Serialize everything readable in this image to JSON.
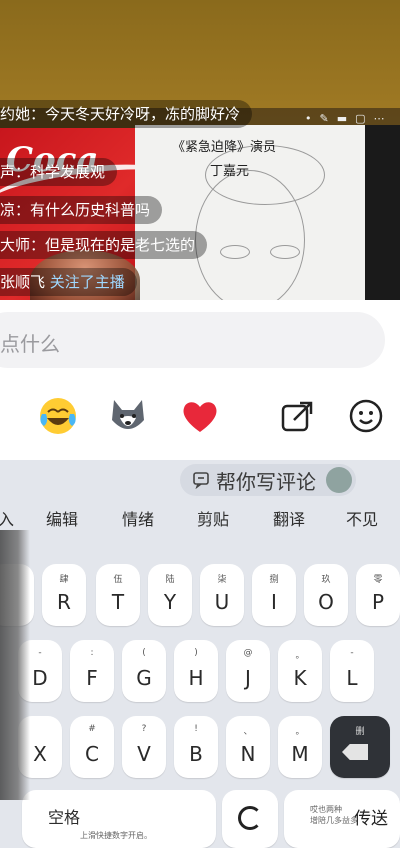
{
  "live": {
    "sketch_title": "《紧急迫降》演员",
    "sketch_name": "丁嘉元",
    "comments": [
      {
        "nick": "约她：",
        "msg": "今天冬天好冷呀，冻的脚好冷"
      },
      {
        "nick": "声：",
        "msg": "科学发展观"
      },
      {
        "nick": "凉：",
        "msg": "有什么历史科普吗"
      },
      {
        "nick": "大师：",
        "msg": "但是现在的是老七选的"
      },
      {
        "nick": "张顺飞",
        "msg": "关注了主播"
      }
    ]
  },
  "comment_input": {
    "placeholder": "点什么"
  },
  "emoji_bar": {
    "items": [
      "tears-of-joy-emoji",
      "husky-dog-emoji",
      "red-heart-emoji"
    ]
  },
  "keyboard": {
    "ai_suggest": "帮你写评论",
    "tools": [
      "入",
      "编辑",
      "情绪",
      "剪贴",
      "翻译",
      "不见"
    ],
    "row1": [
      {
        "sub": "",
        "main": ""
      },
      {
        "sub": "肆",
        "main": "R"
      },
      {
        "sub": "伍",
        "main": "T"
      },
      {
        "sub": "陆",
        "main": "Y"
      },
      {
        "sub": "柒",
        "main": "U"
      },
      {
        "sub": "捌",
        "main": "I"
      },
      {
        "sub": "玖",
        "main": "O"
      },
      {
        "sub": "零",
        "main": "P"
      }
    ],
    "row2": [
      {
        "sub": "-",
        "main": "D"
      },
      {
        "sub": ":",
        "main": "F"
      },
      {
        "sub": "(",
        "main": "G"
      },
      {
        "sub": ")",
        "main": "H"
      },
      {
        "sub": "@",
        "main": "J"
      },
      {
        "sub": "。",
        "main": "K"
      },
      {
        "sub": "-",
        "main": "L"
      }
    ],
    "row3": [
      {
        "sub": "",
        "main": "X"
      },
      {
        "sub": "#",
        "main": "C"
      },
      {
        "sub": "?",
        "main": "V"
      },
      {
        "sub": "!",
        "main": "B"
      },
      {
        "sub": "、",
        "main": "N"
      },
      {
        "sub": "。",
        "main": "M"
      }
    ],
    "delete_sub": "删",
    "space_label": "空格",
    "space_hint": "上滑快捷数字开启。",
    "send_label": "传送",
    "send_tiny": "哎也两种\n增陪几多益多"
  }
}
